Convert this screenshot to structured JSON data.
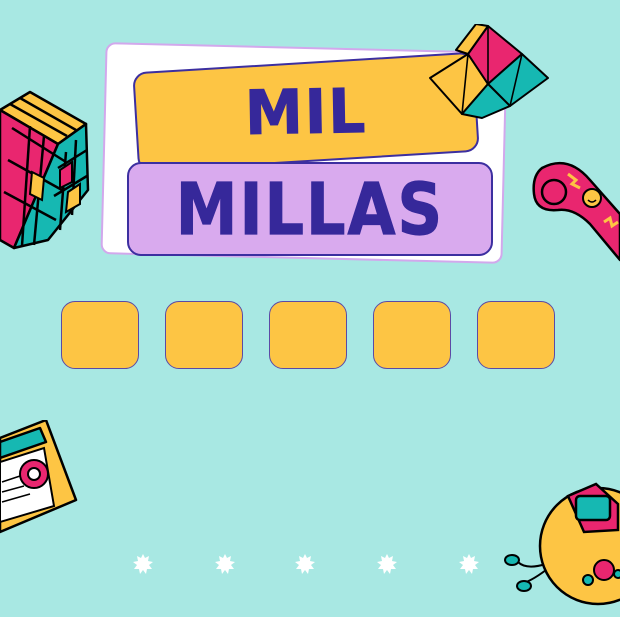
{
  "title": {
    "line1": "MIL",
    "line2": "MILLAS"
  },
  "answer_slots": {
    "count": 5
  },
  "pagination": {
    "count": 5
  },
  "colors": {
    "background": "#a8e8e3",
    "slot_fill": "#fdc544",
    "title_ink": "#36289a",
    "title_top_fill": "#fdc544",
    "title_bottom_fill": "#d9aaee"
  },
  "stickers": [
    "rubiks-cube",
    "paper-fortune-teller",
    "party-blower",
    "vhs-tape",
    "cd-player"
  ]
}
